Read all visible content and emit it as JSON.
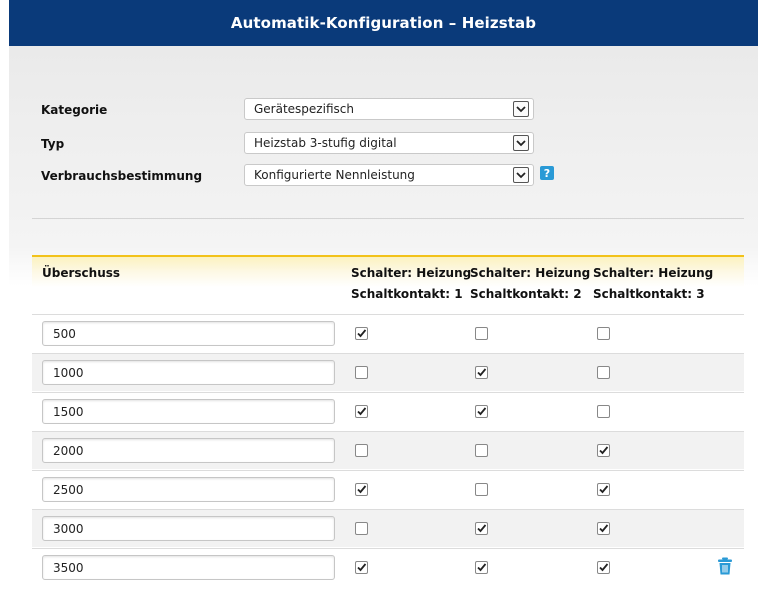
{
  "window": {
    "title": "Automatik-Konfiguration – Heizstab"
  },
  "form": {
    "kategorie": {
      "label": "Kategorie",
      "value": "Gerätespezifisch"
    },
    "typ": {
      "label": "Typ",
      "value": "Heizstab 3-stufig digital"
    },
    "verbrauch": {
      "label": "Verbrauchsbestimmung",
      "value": "Konfigurierte Nennleistung"
    },
    "help_label": "?"
  },
  "table": {
    "header": {
      "col0": "Überschuss",
      "col1_line1": "Schalter: Heizung",
      "col1_line2": "Schaltkontakt: 1",
      "col2_line1": "Schalter: Heizung",
      "col2_line2": "Schaltkontakt: 2",
      "col3_line1": "Schalter: Heizung",
      "col3_line2": "Schaltkontakt: 3"
    },
    "rows": [
      {
        "value": "500",
        "checks": [
          true,
          false,
          false
        ]
      },
      {
        "value": "1000",
        "checks": [
          false,
          true,
          false
        ]
      },
      {
        "value": "1500",
        "checks": [
          true,
          true,
          false
        ]
      },
      {
        "value": "2000",
        "checks": [
          false,
          false,
          true
        ]
      },
      {
        "value": "2500",
        "checks": [
          true,
          false,
          true
        ]
      },
      {
        "value": "3000",
        "checks": [
          false,
          true,
          true
        ]
      },
      {
        "value": "3500",
        "checks": [
          true,
          true,
          true
        ]
      }
    ]
  },
  "colors": {
    "header_bg": "#0a3a7a",
    "accent": "#f2c21a",
    "help_icon": "#2a9ad6"
  }
}
